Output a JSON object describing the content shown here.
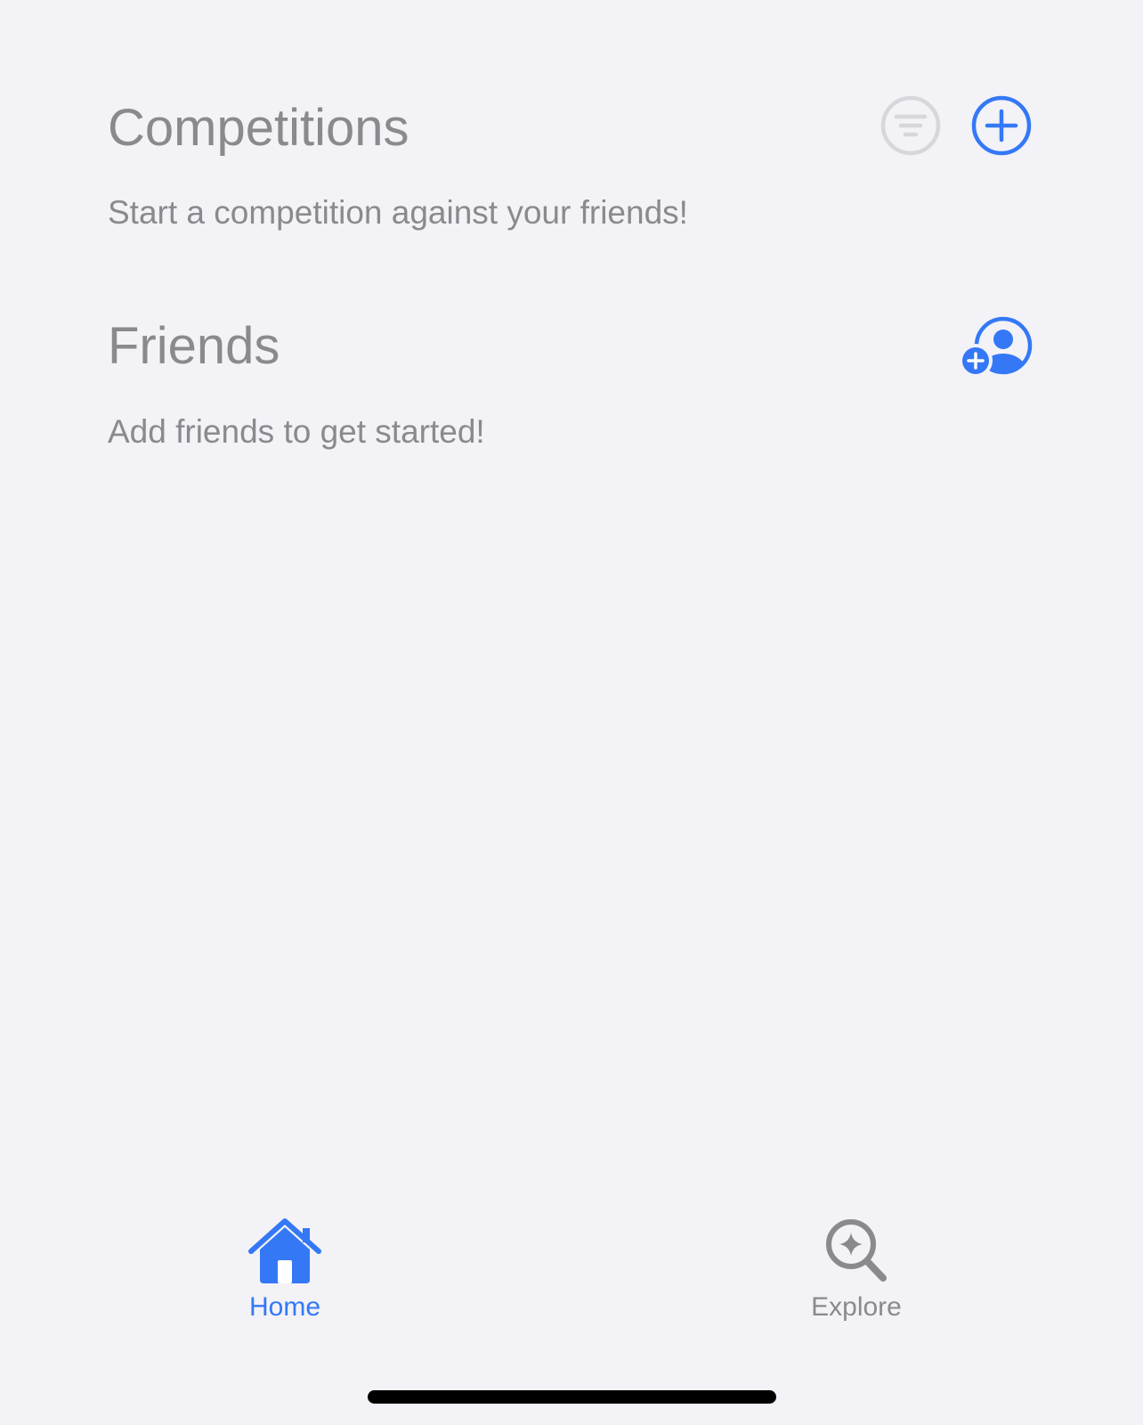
{
  "competitions": {
    "title": "Competitions",
    "subtitle": "Start a competition against your friends!",
    "filter_icon": "filter-circle-icon",
    "add_icon": "plus-circle-icon"
  },
  "friends": {
    "title": "Friends",
    "subtitle": "Add friends to get started!",
    "add_friend_icon": "person-add-icon"
  },
  "tab_bar": {
    "tabs": [
      {
        "label": "Home",
        "icon": "house-icon",
        "selected": true
      },
      {
        "label": "Explore",
        "icon": "sparkle-magnifier-icon",
        "selected": false
      }
    ]
  },
  "colors": {
    "accent": "#3478f6",
    "secondary_text": "#8a8a8e",
    "disabled_icon": "#d6d6db",
    "background": "#f2f2f7"
  }
}
